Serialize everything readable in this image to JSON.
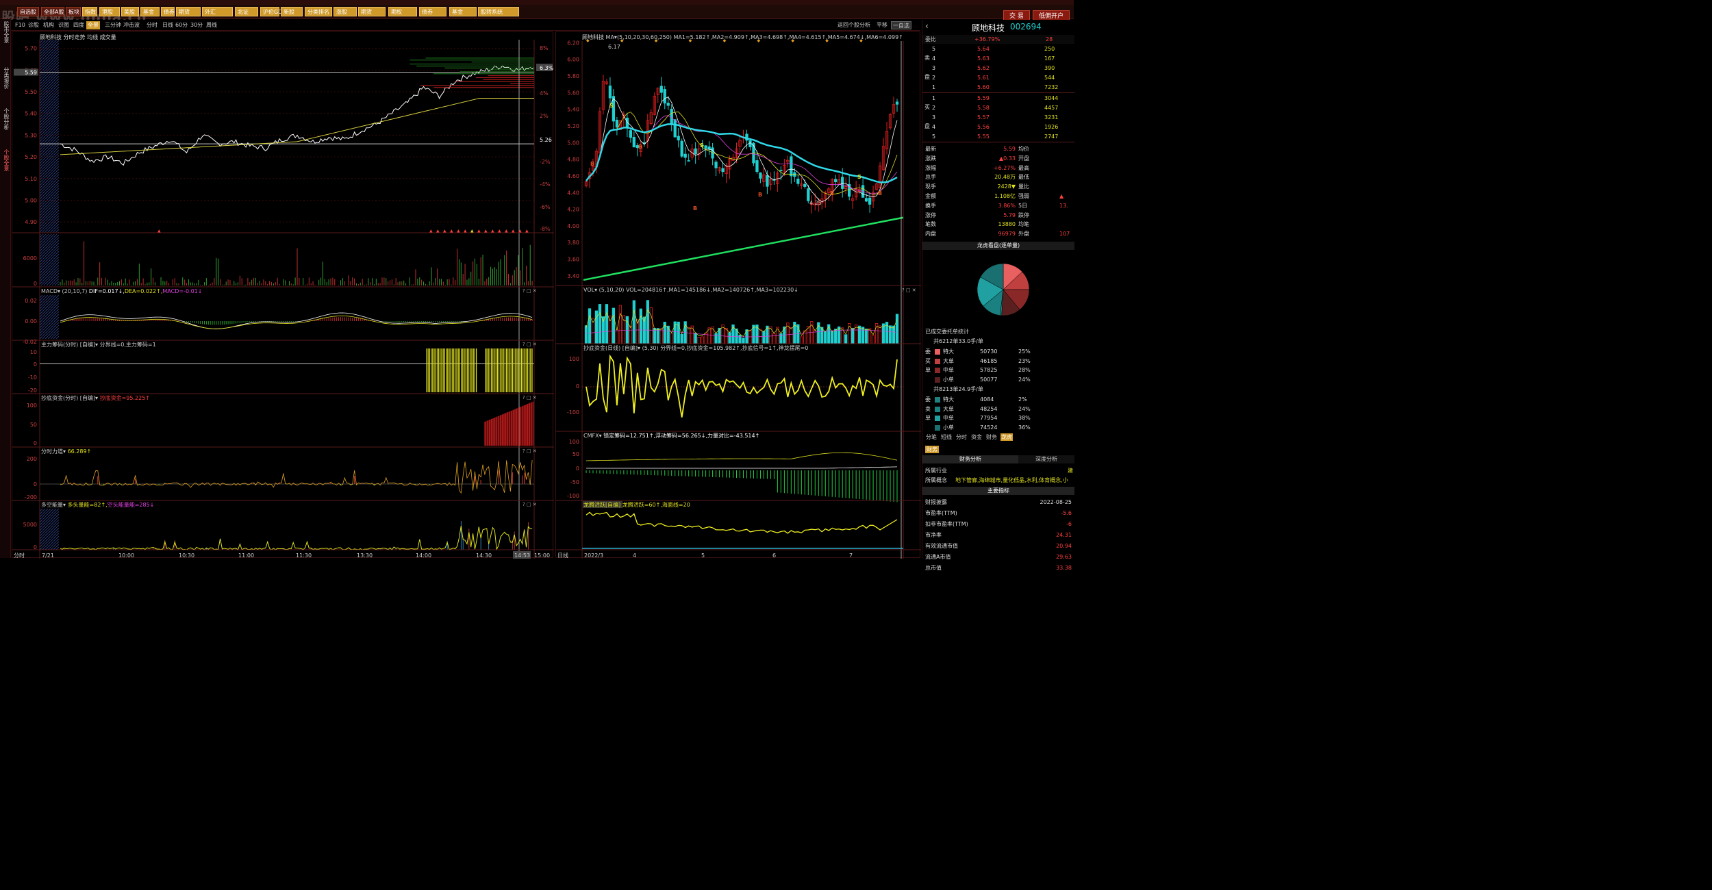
{
  "watermark": "股吧 www.guba.cn",
  "menu": [
    "自选股",
    "全部A股",
    "板块",
    "指数",
    "港股",
    "美股",
    "基金",
    "债券",
    "期货",
    "外汇",
    "北证",
    "沪伦GDR",
    "新股",
    "分类排名",
    "涨股",
    "期货",
    "期权",
    "债券",
    "基金",
    "股转系统",
    "指数",
    "综合排名"
  ],
  "right_buttons": {
    "trade": "交 易",
    "open": "低佣开户"
  },
  "left_tabs": [
    "股市全景",
    "分类报价",
    "个股分析",
    "个股全景"
  ],
  "tabs": [
    "F10",
    "诊股",
    "机构",
    "识图",
    "四度",
    "全景",
    "三分钟",
    "冲击波",
    "分时",
    "日线",
    "60分",
    "30分",
    "周线"
  ],
  "tabs_right": {
    "back": "返回个股分析",
    "flat": "平移",
    "custom": "一自选"
  },
  "left_panel": {
    "title": "顾地科技  分时走势  均线 成交量",
    "price_ticks": [
      "5.70",
      "5.60",
      "5.59",
      "5.50",
      "5.40",
      "5.30",
      "5.20",
      "5.10",
      "5.00",
      "4.90"
    ],
    "pct_ticks": [
      "8%",
      "6.3%",
      "4%",
      "2%",
      "5.26",
      "-2%",
      "-4%",
      "-6%",
      "-8%"
    ],
    "vol_ticks": [
      "6000",
      "0"
    ],
    "macd": {
      "name": "MACD",
      "params": "(20,10,7)",
      "dif": "DIF=0.017",
      "dea": "DEA=0.022",
      "macd": "MACD=-0.01",
      "ticks": [
        "0.02",
        "0.00",
        "-0.02"
      ]
    },
    "zlcm": {
      "name": "主力筹码(分时)",
      "tag": "[自编]",
      "text": "分界线=0,主力筹码=1",
      "ticks": [
        "10",
        "0",
        "-10",
        "-20"
      ]
    },
    "cdzj": {
      "name": "抄底资金(分时)",
      "tag": "[自编]",
      "text": "抄底资金=95.225",
      "ticks": [
        "100",
        "50",
        "0"
      ]
    },
    "fsld": {
      "name": "分时力道",
      "text": "66.289",
      "ticks": [
        "200",
        "0",
        "-200"
      ]
    },
    "dkn": {
      "name": "多空能量",
      "text1": "多头量能=82",
      "text2": "空头能量能=285",
      "ticks": [
        "5000",
        "0"
      ]
    },
    "time_axis": [
      "分时",
      "7/21",
      "10:00",
      "10:30",
      "11:00",
      "11:30",
      "13:30",
      "14:00",
      "14:30",
      "14:53",
      "15:00"
    ]
  },
  "mid_panel": {
    "title": "顾地科技",
    "ma_text": "MA▾(5,10,20,30,60,250)  MA1=5.182↑,MA2=4.909↑,MA3=4.698↑,MA4=4.615↑,MA5=4.674↓,MA6=4.099↑",
    "price_ticks": [
      "6.20",
      "6.00",
      "5.80",
      "5.60",
      "5.40",
      "5.20",
      "5.00",
      "4.80",
      "4.60",
      "4.40",
      "4.20",
      "4.00",
      "3.80",
      "3.60",
      "3.40"
    ],
    "high_label": "6.17",
    "low_label": "4.25",
    "vol": {
      "name": "VOL",
      "params": "(5,10,20)",
      "text": "VOL=204816↑,MA1=145186↓,MA2=140726↑,MA3=102230↓"
    },
    "cdzj": {
      "name": "抄底资金(日线)",
      "tag": "[自编]",
      "params": "(5,30)",
      "text": "分界线=0,抄底资金=105.982↑,抄底信号=1↑,神龙摆尾=0",
      "ticks": [
        "100",
        "0",
        "-100"
      ]
    },
    "cmfx": {
      "name": "CMFX",
      "text": "锁定筹码=12.751↑,浮动筹码=56.265↓,力量对比=-43.514↑",
      "ticks": [
        "100",
        "50",
        "0",
        "-50",
        "-100"
      ]
    },
    "lthy": {
      "name": "龙腾活跃[自编]",
      "text": "龙腾活跃=60↑,海面线=20"
    },
    "time_axis": [
      "日线",
      "2022/3",
      "4",
      "5",
      "6",
      "7"
    ]
  },
  "right_panel": {
    "name": "顾地科技",
    "code": "002694",
    "weibi_label": "委比",
    "weibi": "+36.79%",
    "weicha": "28",
    "sell": [
      {
        "l": "5",
        "p": "5.64",
        "v": "250"
      },
      {
        "l": "4",
        "p": "5.63",
        "v": "167"
      },
      {
        "l": "3",
        "p": "5.62",
        "v": "390"
      },
      {
        "l": "2",
        "p": "5.61",
        "v": "544"
      },
      {
        "l": "1",
        "p": "5.60",
        "v": "7232"
      }
    ],
    "buy": [
      {
        "l": "1",
        "p": "5.59",
        "v": "3044"
      },
      {
        "l": "2",
        "p": "5.58",
        "v": "4457"
      },
      {
        "l": "3",
        "p": "5.57",
        "v": "3231"
      },
      {
        "l": "4",
        "p": "5.56",
        "v": "1926"
      },
      {
        "l": "5",
        "p": "5.55",
        "v": "2747"
      }
    ],
    "sell_side": "卖",
    "sell_side2": "盘",
    "buy_side": "买",
    "buy_side2": "盘",
    "stats": [
      {
        "a": "最新",
        "b": "5.59",
        "c": "均价",
        "d": ""
      },
      {
        "a": "涨跌",
        "b": "▲0.33",
        "c": "开盘",
        "d": ""
      },
      {
        "a": "涨幅",
        "b": "+6.27%",
        "c": "最高",
        "d": ""
      },
      {
        "a": "总手",
        "b": "20.48万",
        "c": "最低",
        "d": ""
      },
      {
        "a": "现手",
        "b": "2428▼",
        "c": "量比",
        "d": ""
      },
      {
        "a": "金额",
        "b": "1.108亿",
        "c": "强弱",
        "d": "▲"
      },
      {
        "a": "换手",
        "b": "3.86%",
        "c": "5日",
        "d": "13."
      },
      {
        "a": "涨停",
        "b": "5.79",
        "c": "跌停",
        "d": ""
      },
      {
        "a": "笔数",
        "b": "13880",
        "c": "均笔",
        "d": ""
      },
      {
        "a": "内盘",
        "b": "96979",
        "c": "外盘",
        "d": "107"
      }
    ],
    "pie_title": "龙虎看盘(逐单量)",
    "order_title": "已成交委托单统计",
    "sell_sum": "共6212单33.0手/单",
    "sell_side_l": [
      "委",
      "买",
      "单",
      ""
    ],
    "sell_orders": [
      {
        "k": "特大",
        "v": "50730",
        "p": "25%"
      },
      {
        "k": "大单",
        "v": "46185",
        "p": "23%"
      },
      {
        "k": "中单",
        "v": "57825",
        "p": "28%"
      },
      {
        "k": "小单",
        "v": "50077",
        "p": "24%"
      }
    ],
    "buy_sum": "共8213单24.9手/单",
    "buy_side_l": [
      "委",
      "卖",
      "单",
      ""
    ],
    "buy_orders": [
      {
        "k": "特大",
        "v": "4084",
        "p": "2%"
      },
      {
        "k": "大单",
        "v": "48254",
        "p": "24%"
      },
      {
        "k": "中单",
        "v": "77954",
        "p": "38%"
      },
      {
        "k": "小单",
        "v": "74524",
        "p": "36%"
      }
    ],
    "subtabs": [
      "分笔",
      "短线",
      "分时",
      "资金",
      "财务",
      "龙虎"
    ],
    "fin_tab": "财务",
    "fin_title": "财务分析",
    "depth_title": "深度分析",
    "industry_label": "所属行业",
    "industry": "建",
    "concept_label": "所属概念",
    "concept": "地下管廊,海绵城市,量化低晶,水利,体育概念,小",
    "main_index": "主要指标",
    "fin": [
      {
        "k": "财报披露",
        "v": "2022-08-25"
      },
      {
        "k": "市盈率(TTM)",
        "v": "-5.6"
      },
      {
        "k": "扣非市盈率(TTM)",
        "v": "-6"
      },
      {
        "k": "市净率",
        "v": "24.31"
      },
      {
        "k": "有效流通市值",
        "v": "20.94"
      },
      {
        "k": "流通A市值",
        "v": "29.63"
      },
      {
        "k": "总市值",
        "v": "33.38"
      }
    ]
  }
}
